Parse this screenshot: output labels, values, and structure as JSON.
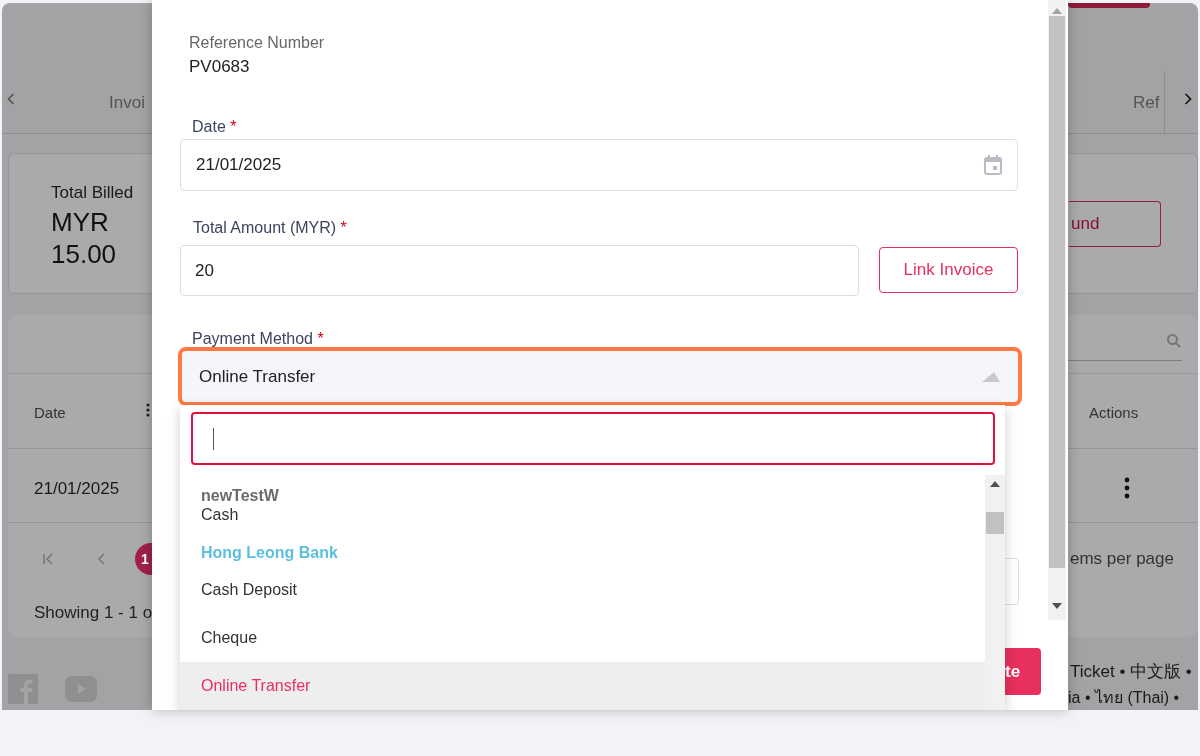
{
  "background": {
    "tabs": {
      "left": "Invoi",
      "right": "Ref"
    },
    "summary": {
      "label": "Total Billed",
      "value": "MYR 15.00"
    },
    "refund_button": "und",
    "table": {
      "columns": [
        "Date",
        "Actions"
      ],
      "rows": [
        {
          "date": "21/01/2025"
        }
      ]
    },
    "pagination": {
      "page": "1",
      "showing": "Showing 1 - 1 o",
      "per_page": "ems per page"
    },
    "footer_links": [
      "Ticket • 中文版 •",
      "ia • ไทย (Thai) •"
    ]
  },
  "modal": {
    "reference": {
      "label": "Reference Number",
      "value": "PV0683"
    },
    "date": {
      "label": "Date",
      "required_mark": "*",
      "value": "21/01/2025"
    },
    "amount": {
      "label": "Total Amount (MYR)",
      "required_mark": "*",
      "value": "20"
    },
    "link_button": "Link Invoice",
    "payment_method": {
      "label": "Payment Method",
      "required_mark": "*",
      "value": "Online Transfer",
      "expanded": true,
      "highlighted": true
    },
    "dropdown": {
      "groups": [
        {
          "label": "newTestW",
          "color": "#6b6b6b",
          "options": [
            {
              "label": "Cash",
              "selected": false
            }
          ]
        },
        {
          "label": "Hong Leong Bank",
          "color": "#5bc0de",
          "options": [
            {
              "label": "Cash Deposit",
              "selected": false
            },
            {
              "label": "Cheque",
              "selected": false
            },
            {
              "label": "Online Transfer",
              "selected": true
            }
          ]
        }
      ]
    },
    "submit_button": "te"
  }
}
